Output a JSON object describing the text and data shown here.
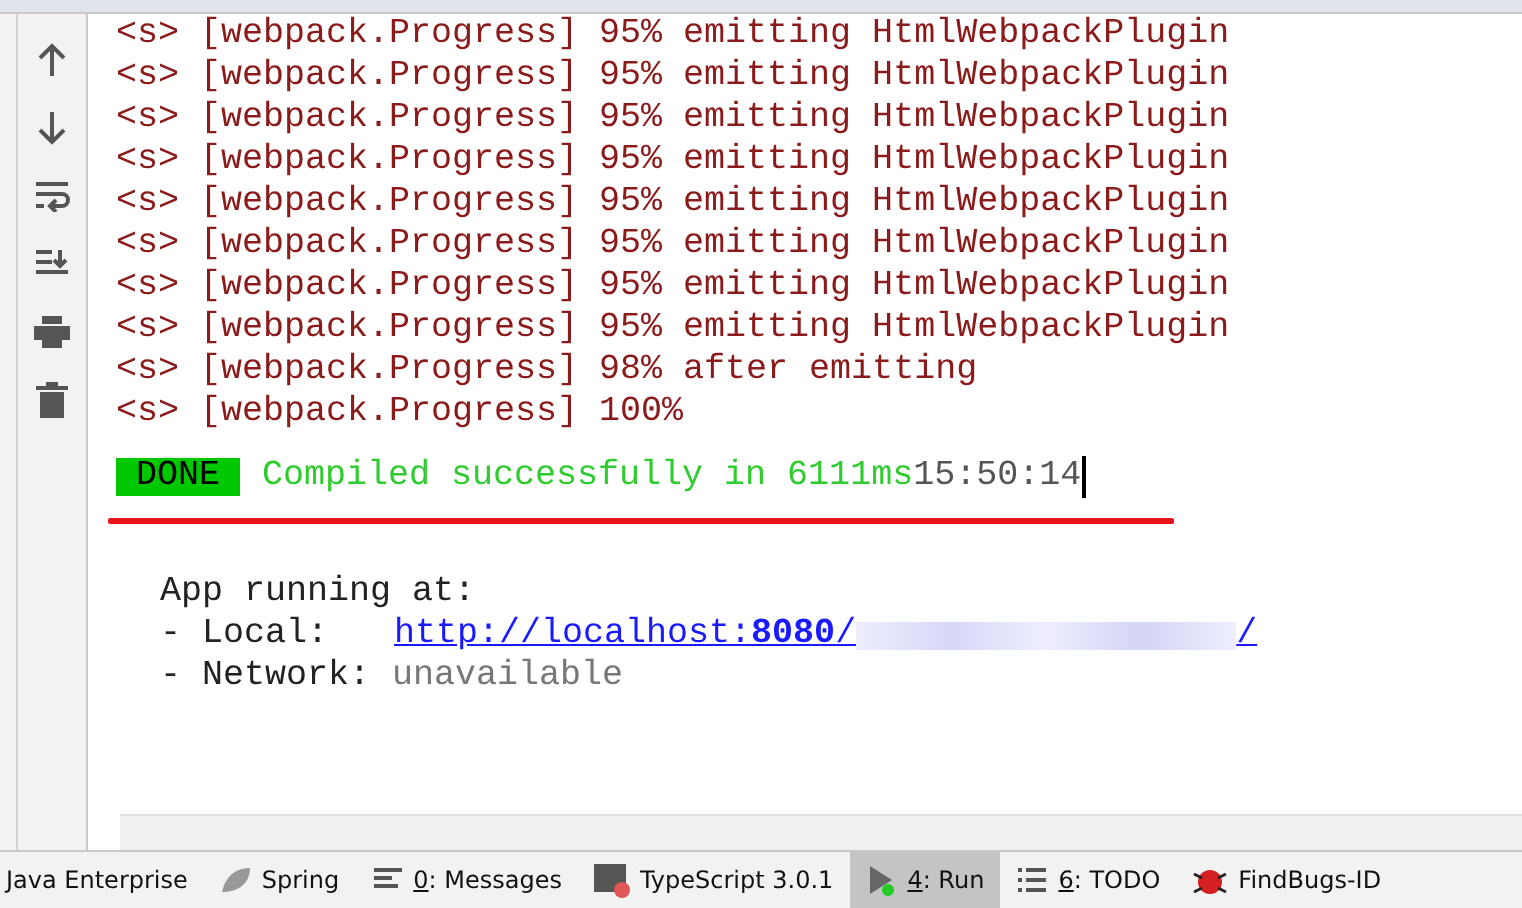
{
  "log_lines": [
    "<s> [webpack.Progress] 95% emitting HtmlWebpackPlugin",
    "<s> [webpack.Progress] 95% emitting HtmlWebpackPlugin",
    "<s> [webpack.Progress] 95% emitting HtmlWebpackPlugin",
    "<s> [webpack.Progress] 95% emitting HtmlWebpackPlugin",
    "<s> [webpack.Progress] 95% emitting HtmlWebpackPlugin",
    "<s> [webpack.Progress] 95% emitting HtmlWebpackPlugin",
    "<s> [webpack.Progress] 95% emitting HtmlWebpackPlugin",
    "<s> [webpack.Progress] 95% emitting HtmlWebpackPlugin",
    "<s> [webpack.Progress] 98% after emitting",
    "<s> [webpack.Progress] 100%"
  ],
  "done": {
    "badge": "DONE",
    "message": "Compiled successfully in 6111ms",
    "time": "15:50:14"
  },
  "app": {
    "heading": "App running at:",
    "local_label": "- Local:",
    "local_url": "http://localhost:**8080**/",
    "local_url_end": "/",
    "network_label": "- Network:",
    "network_value": "unavailable"
  },
  "tool_tabs": [
    {
      "kind": "plain",
      "label": "Java Enterprise",
      "selected": false
    },
    {
      "kind": "spring",
      "label": "Spring",
      "selected": false
    },
    {
      "kind": "messages",
      "number": "0",
      "label": ": Messages",
      "selected": false
    },
    {
      "kind": "typescript",
      "label": "TypeScript 3.0.1",
      "selected": false
    },
    {
      "kind": "run",
      "number": "4",
      "label": ": Run",
      "selected": true
    },
    {
      "kind": "todo",
      "number": "6",
      "label": ": TODO",
      "selected": false
    },
    {
      "kind": "findbugs",
      "label": "FindBugs-ID",
      "selected": false
    }
  ]
}
